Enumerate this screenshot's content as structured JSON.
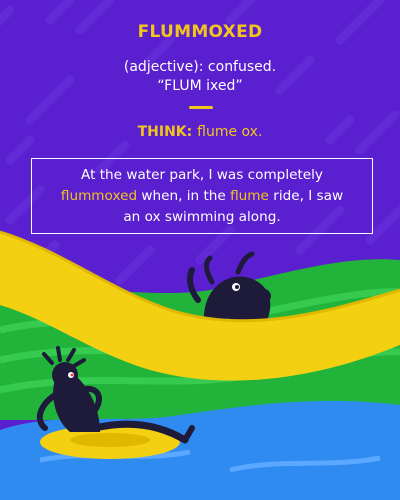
{
  "card": {
    "word": "FLUMMOXED",
    "part_of_speech_line": "(adjective): confused.",
    "pronunciation": "“FLUM ixed”",
    "think_label": "THINK:",
    "think_text": "flume ox.",
    "sentence": {
      "part1": "At the water park, I was completely",
      "highlight1": "flummoxed",
      "part2": " when, in the ",
      "highlight2": "flume",
      "part3": " ride, I saw",
      "part4": "an ox swimming along."
    }
  },
  "colors": {
    "background": "#5a1fcf",
    "accent_yellow": "#f2c51c",
    "text_white": "#ffffff",
    "grass_green": "#22b43a",
    "water_blue": "#2f8bf0",
    "slide_yellow": "#f4d012",
    "figure_dark": "#1e1a3a"
  }
}
